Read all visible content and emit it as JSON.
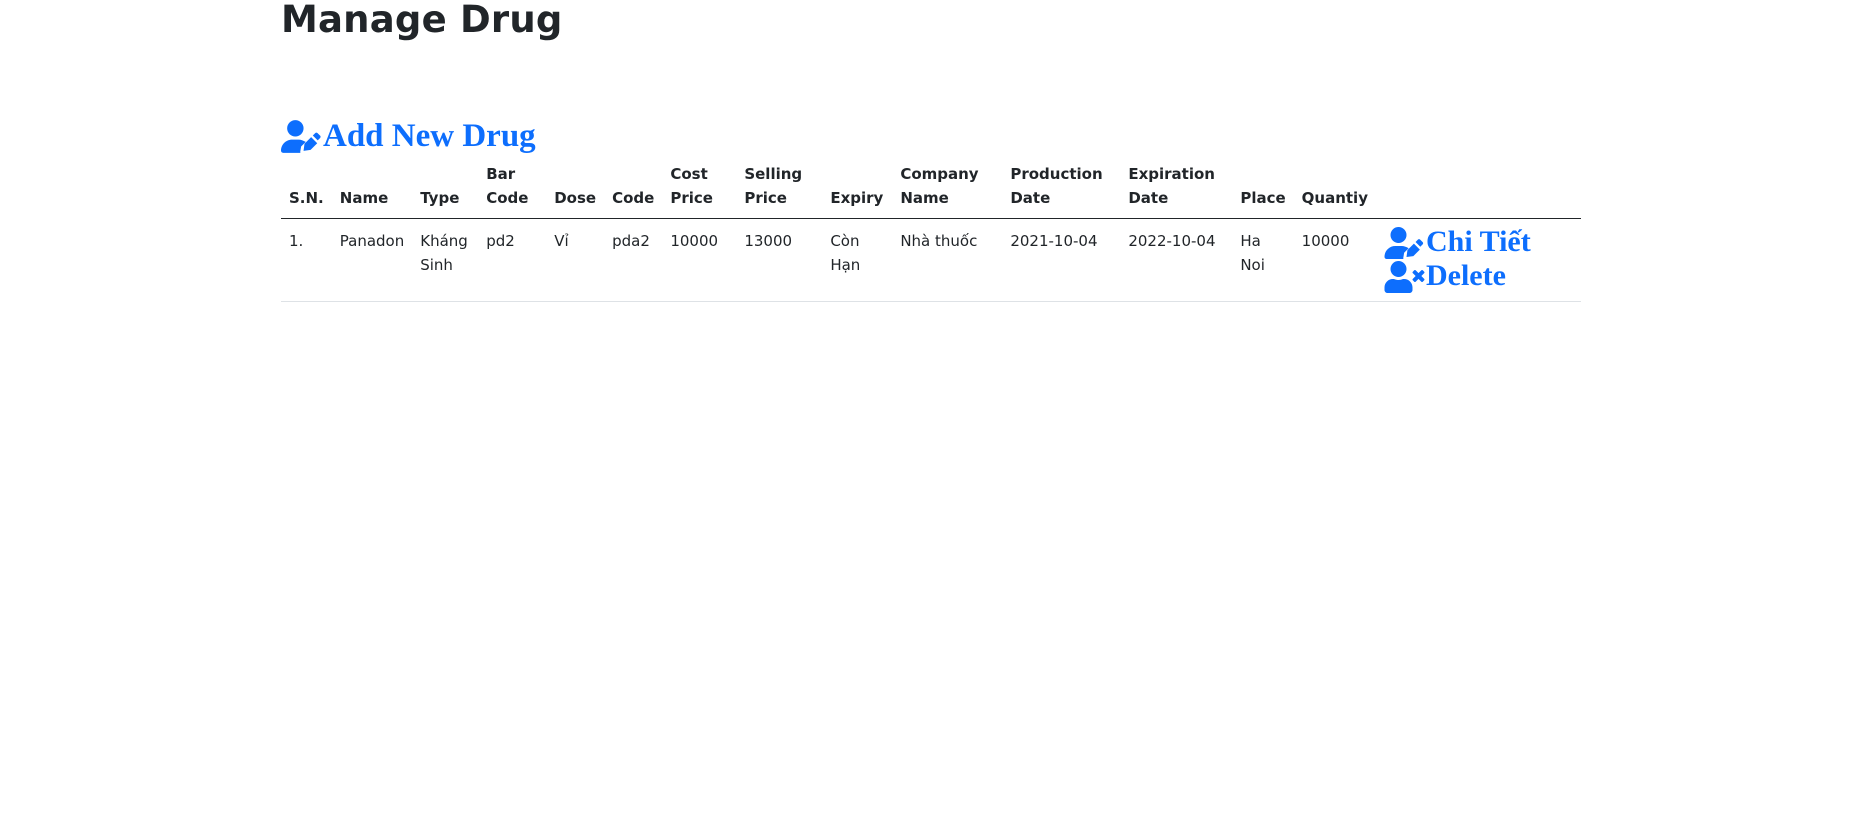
{
  "page": {
    "title": "Manage Drug"
  },
  "actions": {
    "add_label": "Add New Drug",
    "add_icon": "user-edit-icon"
  },
  "colors": {
    "link": "#0d6efd",
    "text": "#212529",
    "row_border": "#dee2e6"
  },
  "table": {
    "headers": {
      "sn": "S.N.",
      "name": "Name",
      "type": "Type",
      "bar_code": "Bar Code",
      "dose": "Dose",
      "code": "Code",
      "cost_price": "Cost Price",
      "selling_price": "Selling Price",
      "expiry": "Expiry",
      "company_name": "Company Name",
      "production_date": "Production Date",
      "expiration_date": "Expiration Date",
      "place": "Place",
      "quantity": "Quantiy"
    },
    "rows": [
      {
        "sn": "1.",
        "name": "Panadon",
        "type": "Kháng Sinh",
        "bar_code": "pd2",
        "dose": "Vỉ",
        "code": "pda2",
        "cost_price": "10000",
        "selling_price": "13000",
        "expiry": "Còn Hạn",
        "company_name": "Nhà thuốc",
        "production_date": "2021-10-04",
        "expiration_date": "2022-10-04",
        "place": "Ha Noi",
        "quantity": "10000",
        "detail_label": "Chi Tiết",
        "detail_icon": "user-edit-icon",
        "delete_label": "Delete",
        "delete_icon": "user-times-icon"
      }
    ]
  }
}
